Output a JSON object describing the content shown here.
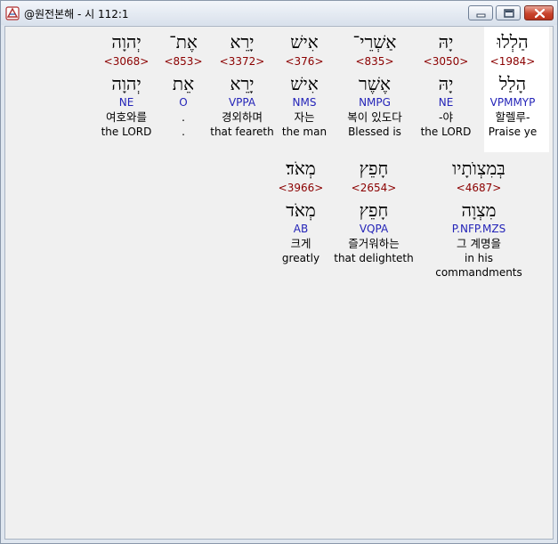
{
  "window": {
    "title": "@원전본해 - 시 112:1",
    "minimize_label": "minimize",
    "maximize_label": "maximize",
    "close_label": "close"
  },
  "verse_words": [
    {
      "hebrew": "הַלְלוּ",
      "strong": "<1984>",
      "root": "הָלַל",
      "morph": "VPMMYP",
      "korean": "할렐루-",
      "english": "Praise ye",
      "selected": true
    },
    {
      "hebrew": "יָהּ",
      "strong": "<3050>",
      "root": "יָהּ",
      "morph": "NE",
      "korean": "-야",
      "english": "the LORD"
    },
    {
      "hebrew": "אַשְׁרֵי־",
      "strong": "<835>",
      "root": "אֶשֶׁר",
      "morph": "NMPG",
      "korean": "복이 있도다",
      "english": "Blessed is"
    },
    {
      "hebrew": "אִישׁ",
      "strong": "<376>",
      "root": "אִישׁ",
      "morph": "NMS",
      "korean": "자는",
      "english": "the man"
    },
    {
      "hebrew": "יָרֵא",
      "strong": "<3372>",
      "root": "יָרֵא",
      "morph": "VPPA",
      "korean": "경외하며",
      "english": "that feareth"
    },
    {
      "hebrew": "אֶת־",
      "strong": "<853>",
      "root": "אֵת",
      "morph": "O",
      "korean": ".",
      "english": "."
    },
    {
      "hebrew": "יְהוָה",
      "strong": "<3068>",
      "root": "יְהוָה",
      "morph": "NE",
      "korean": "여호와를",
      "english": "the LORD"
    },
    {
      "hebrew": "בְּמִצְוֺתָיו",
      "strong": "<4687>",
      "root": "מִצְוָה",
      "morph": "P.NFP.MZS",
      "korean": "그 계명을",
      "english": "in his commandments"
    },
    {
      "hebrew": "חָפֵץ",
      "strong": "<2654>",
      "root": "חָפֵץ",
      "morph": "VQPA",
      "korean": "즐거워하는",
      "english": "that delighteth"
    },
    {
      "hebrew": "מְאֹד׃",
      "strong": "<3966>",
      "root": "מְאֹד",
      "morph": "AB",
      "korean": "크게",
      "english": "greatly"
    }
  ]
}
